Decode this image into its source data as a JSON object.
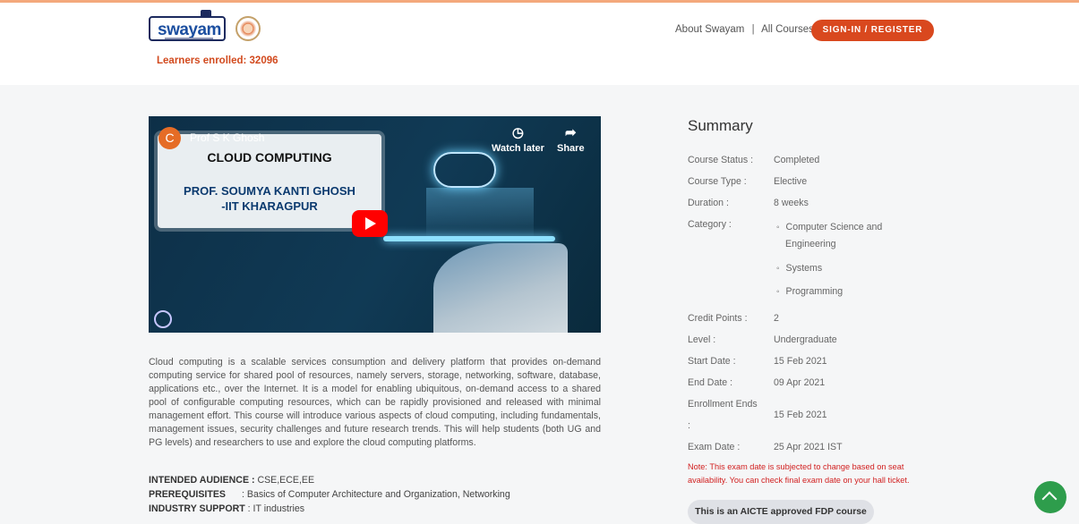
{
  "header": {
    "logo_text": "swayam",
    "nav": [
      "About Swayam",
      "All Courses"
    ],
    "nav_sep": "|",
    "signin_label": "SIGN-IN / REGISTER"
  },
  "enrollment": {
    "text": "Learners enrolled: 32096"
  },
  "video": {
    "channel_initial": "C",
    "channel_name": "Prof S K Ghosh",
    "title_line": "CLOUD COMPUTING",
    "presenter_line1": "PROF. SOUMYA KANTI GHOSH",
    "presenter_line2": "-IIT KHARAGPUR",
    "watch_later": "Watch later",
    "share": "Share",
    "icons": [
      "clock-icon",
      "share-icon",
      "play-icon"
    ]
  },
  "description": "Cloud computing is a scalable services consumption and delivery platform that provides on-demand computing service for shared pool of resources, namely servers, storage, networking, software, database, applications etc., over the Internet. It is a model for enabling ubiquitous, on-demand access to a shared pool of configurable computing resources, which can be rapidly provisioned and released with minimal management effort. This course will introduce various aspects of cloud computing, including fundamentals, management issues, security challenges and future research trends. This will help students (both UG and PG levels) and researchers to use and explore the cloud computing platforms.",
  "meta": {
    "audience_label": "INTENDED AUDIENCE :",
    "audience_value": "CSE,ECE,EE",
    "prereq_label": "PREREQUISITES",
    "prereq_value": ": Basics of Computer Architecture and Organization, Networking",
    "industry_label": "INDUSTRY SUPPORT",
    "industry_value": ": IT industries"
  },
  "summary": {
    "title": "Summary",
    "status_label": "Course Status :",
    "status_value": "Completed",
    "type_label": "Course Type :",
    "type_value": "Elective",
    "duration_label": "Duration :",
    "duration_value": "8 weeks",
    "category_label": "Category :",
    "categories": [
      "Computer Science and",
      "Engineering",
      "Systems",
      "Programming"
    ],
    "credit_label": "Credit Points :",
    "credit_value": "2",
    "level_label": "Level :",
    "level_value": "Undergraduate",
    "start_label": "Start Date :",
    "start_value": "15 Feb 2021",
    "end_label": "End Date :",
    "end_value": "09 Apr 2021",
    "enroll_ends_label": "Enrollment Ends",
    "enroll_ends_colon": ":",
    "enroll_ends_value": "15 Feb 2021",
    "exam_label": "Exam Date :",
    "exam_value": "25 Apr 2021 IST",
    "note_line1": "Note: This exam date is subjected to change based on seat",
    "note_line2": "availability. You can check final exam date on your hall ticket.",
    "aicte": "This is an AICTE approved FDP course"
  },
  "colors": {
    "accent": "#d9481e",
    "scroll_button": "#2e9d4c",
    "note": "#d11f1f"
  }
}
